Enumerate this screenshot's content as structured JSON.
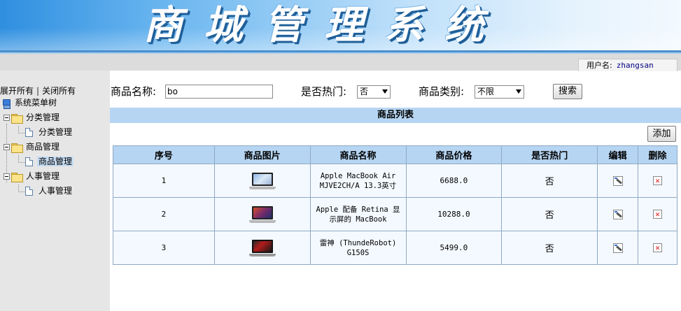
{
  "banner": {
    "title": "商城管理系统"
  },
  "userbar": {
    "label": "用户名:",
    "username": "zhangsan"
  },
  "sidebar": {
    "expand_all": "展开所有",
    "collapse_all": "关闭所有",
    "separator": "|",
    "root": "系统菜单树",
    "groups": [
      {
        "label": "分类管理",
        "children": [
          {
            "label": "分类管理"
          }
        ]
      },
      {
        "label": "商品管理",
        "children": [
          {
            "label": "商品管理",
            "selected": true
          }
        ]
      },
      {
        "label": "人事管理",
        "children": [
          {
            "label": "人事管理"
          }
        ]
      }
    ]
  },
  "search": {
    "name_label": "商品名称:",
    "name_value": "bo",
    "hot_label": "是否热门:",
    "hot_value": "否",
    "category_label": "商品类别:",
    "category_value": "不限",
    "search_button": "搜索"
  },
  "list": {
    "title": "商品列表",
    "add_button": "添加",
    "columns": [
      "序号",
      "商品图片",
      "商品名称",
      "商品价格",
      "是否热门",
      "编辑",
      "删除"
    ],
    "rows": [
      {
        "index": "1",
        "image": "macbook-air-thumbnail",
        "name": "Apple MacBook Air MJVE2CH/A 13.3英寸",
        "price": "6688.0",
        "hot": "否"
      },
      {
        "index": "2",
        "image": "macbook-retina-thumbnail",
        "name": "Apple 配备 Retina 显示屏的 MacBook",
        "price": "10288.0",
        "hot": "否"
      },
      {
        "index": "3",
        "image": "thunderobot-laptop-thumbnail",
        "name": "雷神 (ThundeRobot) G150S",
        "price": "5499.0",
        "hot": "否"
      }
    ]
  },
  "icons": {
    "edit": "edit-icon",
    "delete": "delete-icon",
    "folder": "folder-icon",
    "page": "page-icon",
    "collapse": "minus-box-icon",
    "root": "computer-icon"
  },
  "colors": {
    "header_blue": "#b6d5f2",
    "row_bg": "#f4f9ff",
    "sidebar_bg": "#e6e6e6",
    "selected_bg": "#c6ddf3"
  }
}
